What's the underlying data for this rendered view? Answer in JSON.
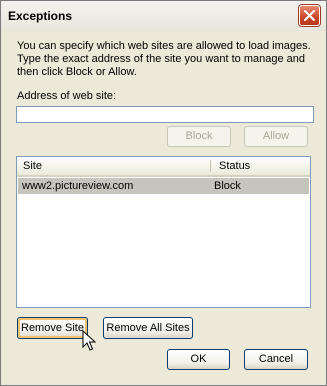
{
  "window": {
    "title": "Exceptions"
  },
  "description": "You can specify which web sites are allowed to load images. Type the exact address of the site you want to manage and then click Block or Allow.",
  "address": {
    "label": "Address of web site:",
    "value": ""
  },
  "buttons": {
    "block": "Block",
    "allow": "Allow",
    "remove_site": "Remove Site",
    "remove_all_sites": "Remove All Sites",
    "ok": "OK",
    "cancel": "Cancel"
  },
  "table": {
    "columns": [
      "Site",
      "Status"
    ],
    "rows": [
      {
        "site": "www2.pictureview.com",
        "status": "Block",
        "selected": true
      }
    ]
  },
  "icons": {
    "close": "close-icon",
    "cursor": "mouse-pointer-icon"
  },
  "colors": {
    "close_button": "#c9472a",
    "selected_row": "#c6c5bd",
    "focus_ring": "#f2c26b"
  }
}
